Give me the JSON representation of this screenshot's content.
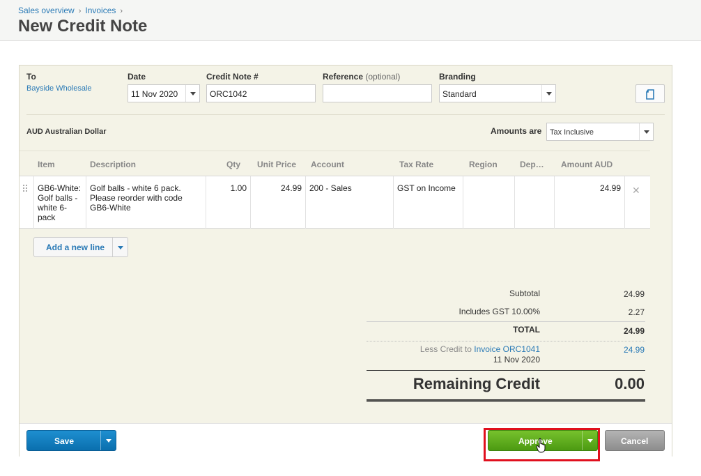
{
  "breadcrumb": {
    "items": [
      "Sales overview",
      "Invoices"
    ],
    "separator": "›"
  },
  "page": {
    "title": "New Credit Note"
  },
  "form": {
    "to_label": "To",
    "to_value": "Bayside Wholesale",
    "date_label": "Date",
    "date_value": "11 Nov 2020",
    "credit_note_label": "Credit Note #",
    "credit_note_value": "ORC1042",
    "reference_label": "Reference",
    "reference_optional": "(optional)",
    "reference_value": "",
    "branding_label": "Branding",
    "branding_value": "Standard",
    "currency": "AUD Australian Dollar",
    "amounts_label": "Amounts are",
    "amounts_value": "Tax Inclusive"
  },
  "table": {
    "headers": [
      "Item",
      "Description",
      "Qty",
      "Unit Price",
      "Account",
      "Tax Rate",
      "Region",
      "Dep…",
      "Amount AUD"
    ],
    "rows": [
      {
        "item": "GB6-White: Golf balls - white 6-pack",
        "description": "Golf balls - white 6 pack. Please reorder with code GB6-White",
        "qty": "1.00",
        "unit_price": "24.99",
        "account": "200 - Sales",
        "tax_rate": "GST on Income",
        "region": "",
        "department": "",
        "amount": "24.99"
      }
    ]
  },
  "add_line": {
    "label": "Add a new line"
  },
  "totals": {
    "subtotal_label": "Subtotal",
    "subtotal_value": "24.99",
    "gst_label": "Includes GST 10.00%",
    "gst_value": "2.27",
    "total_label": "TOTAL",
    "total_value": "24.99",
    "less_credit_label": "Less Credit to",
    "less_credit_link": "Invoice ORC1041",
    "less_credit_date": "11 Nov 2020",
    "less_credit_value": "24.99",
    "remaining_label": "Remaining Credit",
    "remaining_value": "0.00"
  },
  "footer": {
    "save_label": "Save",
    "approve_label": "Approve",
    "cancel_label": "Cancel"
  },
  "colors": {
    "link_blue": "#2a7ab6",
    "save_blue": "#1380c3",
    "approve_green": "#5fae1e",
    "cancel_grey": "#a0a0a0",
    "highlight_red": "#e0101e",
    "panel_bg": "#f4f3e7"
  }
}
